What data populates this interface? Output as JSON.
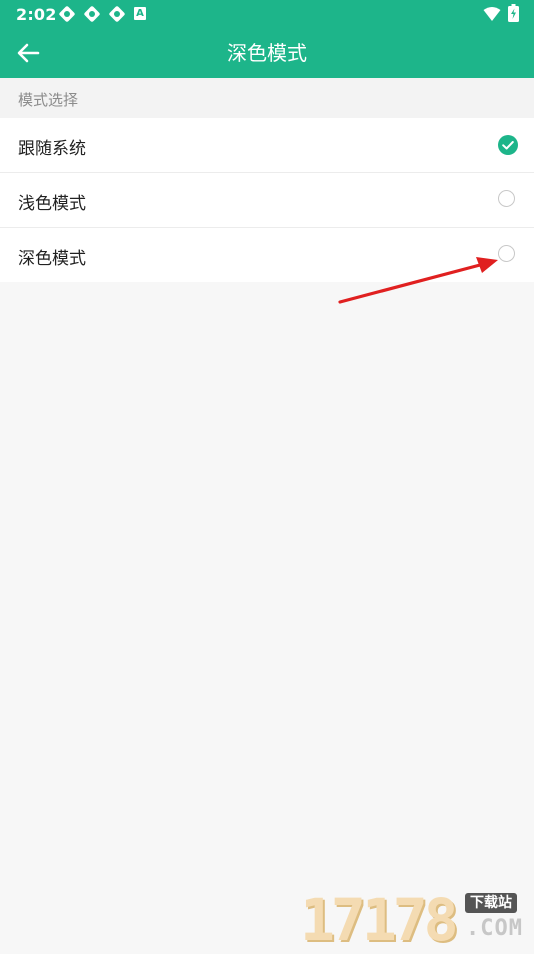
{
  "status_bar": {
    "time": "2:02",
    "notification_icons": [
      "notification-icon",
      "notification-icon",
      "notification-icon"
    ],
    "app_badge": "A"
  },
  "header": {
    "title": "深色模式",
    "back_icon": "back-arrow-icon"
  },
  "section": {
    "title": "模式选择"
  },
  "options": [
    {
      "label": "跟随系统",
      "selected": true
    },
    {
      "label": "浅色模式",
      "selected": false
    },
    {
      "label": "深色模式",
      "selected": false
    }
  ],
  "colors": {
    "accent": "#1db58a",
    "annotation": "#e02020"
  },
  "watermark": {
    "digits": "17178",
    "badge": "下载站",
    "domain": ".COM"
  }
}
